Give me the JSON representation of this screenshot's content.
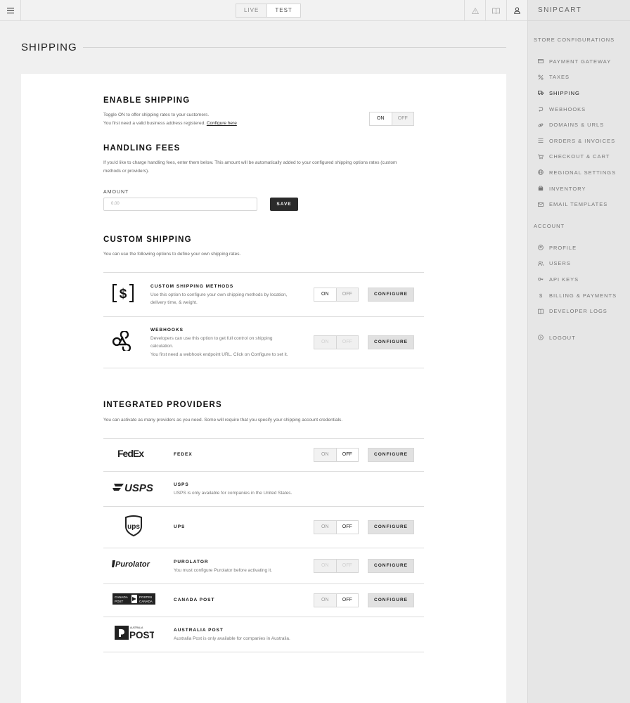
{
  "topbar": {
    "mode_live": "LIVE",
    "mode_test": "TEST"
  },
  "sidebar": {
    "brand": "SNIPCART",
    "section_store": "STORE CONFIGURATIONS",
    "store_items": [
      "PAYMENT GATEWAY",
      "TAXES",
      "SHIPPING",
      "WEBHOOKS",
      "DOMAINS & URLS",
      "ORDERS & INVOICES",
      "CHECKOUT & CART",
      "REGIONAL SETTINGS",
      "INVENTORY",
      "EMAIL TEMPLATES"
    ],
    "section_account": "ACCOUNT",
    "account_items": [
      "PROFILE",
      "USERS",
      "API KEYS",
      "BILLING & PAYMENTS",
      "DEVELOPER LOGS"
    ],
    "logout": "LOGOUT"
  },
  "page": {
    "title": "SHIPPING"
  },
  "enable_shipping": {
    "title": "ENABLE SHIPPING",
    "line1": "Toggle ON to offer shipping rates to your customers.",
    "line2": "You first need a valid business address registered.",
    "link": "Configure here",
    "toggle_on": "ON",
    "toggle_off": "OFF",
    "state": "on"
  },
  "handling_fees": {
    "title": "HANDLING FEES",
    "line1": "If you'd like to charge handling fees, enter them below. This amount will be automatically added to your configured shipping options rates (custom",
    "line2": "methods or providers).",
    "amount_label": "AMOUNT",
    "amount_placeholder": "0.00",
    "save_label": "SAVE"
  },
  "custom_shipping": {
    "title": "CUSTOM SHIPPING",
    "desc": "You can use the following options to define your own shipping rates.",
    "methods": {
      "title": "CUSTOM SHIPPING METHODS",
      "line1": "Use this option to configure your own shipping methods by location,",
      "line2": "delivery time, & weight.",
      "toggle_on": "ON",
      "toggle_off": "OFF",
      "state": "on",
      "configure": "CONFIGURE"
    },
    "webhooks": {
      "title": "WEBHOOKS",
      "line1": "Developers can use this option to get full control on shipping",
      "line2": "calculation.",
      "line3": "You first need a webhook endpoint URL. Click on Configure to set it.",
      "toggle_on": "ON",
      "toggle_off": "OFF",
      "state": "disabled",
      "configure": "CONFIGURE"
    }
  },
  "providers": {
    "title": "INTEGRATED PROVIDERS",
    "desc": "You can activate as many providers as you need. Some will require that you specify your shipping account credentials.",
    "fedex": {
      "name": "FEDEX",
      "logo": "FedEx",
      "toggle_on": "ON",
      "toggle_off": "OFF",
      "state": "off",
      "configure": "CONFIGURE"
    },
    "usps": {
      "name": "USPS",
      "logo": "USPS",
      "desc": "USPS is only available for companies in the United States."
    },
    "ups": {
      "name": "UPS",
      "logo": "ups",
      "toggle_on": "ON",
      "toggle_off": "OFF",
      "state": "off",
      "configure": "CONFIGURE"
    },
    "purolator": {
      "name": "PUROLATOR",
      "logo": "Purolator",
      "desc": "You must configure Purolator before activating it.",
      "toggle_on": "ON",
      "toggle_off": "OFF",
      "state": "disabled",
      "configure": "CONFIGURE"
    },
    "canada_post": {
      "name": "CANADA POST",
      "logo_tl": "CANADA",
      "logo_tr": "POSTES",
      "logo_bl": "POST",
      "logo_br": "CANADA",
      "toggle_on": "ON",
      "toggle_off": "OFF",
      "state": "off",
      "configure": "CONFIGURE"
    },
    "australia_post": {
      "name": "AUSTRALIA POST",
      "logo_small": "AUSTRALIA",
      "logo": "POST",
      "desc": "Australia Post is only available for companies in Australia."
    }
  }
}
